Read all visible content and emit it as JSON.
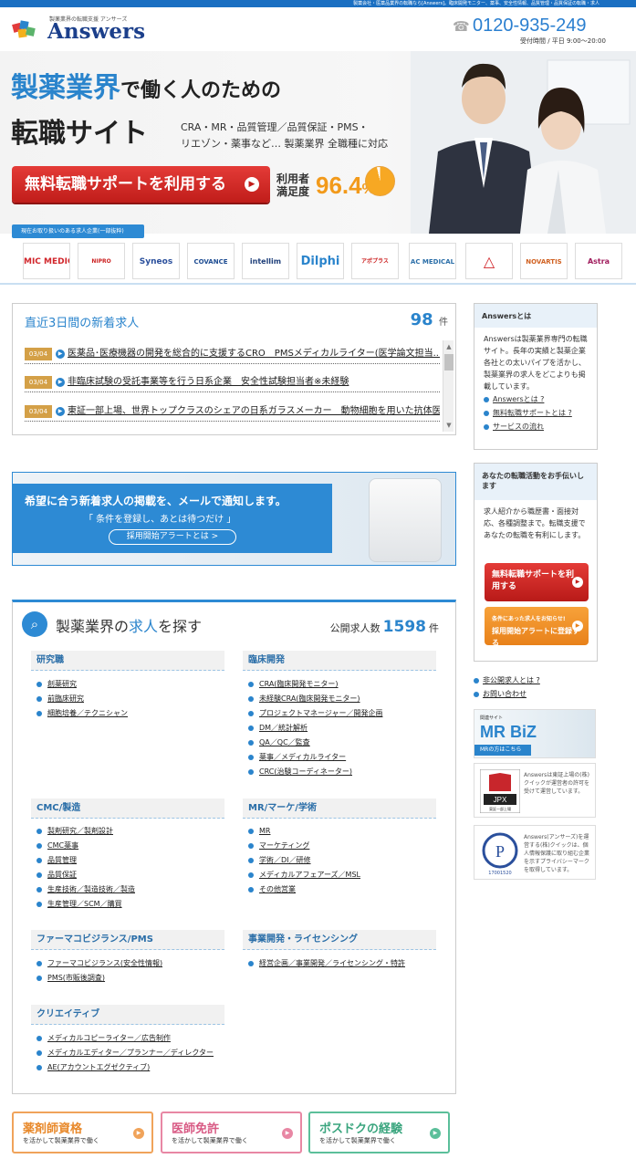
{
  "topbar": {
    "text": "製薬会社・医薬品業界の転職なら[Answers]。臨床開発モニター、薬事、安全性情報、品質管理・品質保証の転職・求人"
  },
  "header": {
    "logo_sub": "製薬業界の転職支援 アンサーズ",
    "logo_text": "Answers",
    "phone": "0120-935-249",
    "hours": "受付時間 / 平日 9:00〜20:00"
  },
  "hero": {
    "title_a": "製薬業界",
    "title_b": "で働く人のための",
    "title_c": "転職サイト",
    "sub1": "CRA・MR・品質管理／品質保証・PMS・",
    "sub2": "リエゾン・薬事など… 製薬業界 全職種に対応",
    "cta": "無料転職サポートを利用する",
    "sat_label": "利用者満足度",
    "sat_value": "96.4",
    "sat_unit": "%"
  },
  "clients": {
    "tag": "現在お取り扱いのある求人企業(一部抜粋)",
    "items": [
      "MIC MEDICAL",
      "NIPRO",
      "Syneos",
      "COVANCE",
      "intellim",
      "Dilphi",
      "アポプラス",
      "AC MEDICAL",
      "△",
      "NOVARTIS",
      "Astra"
    ]
  },
  "jobs": {
    "title": "直近3日間の新着求人",
    "count": "98",
    "unit": "件",
    "rows": [
      {
        "date": "03/04",
        "text": "医薬品･医療機器の開発を総合的に支援するCRO　PMSメディカルライター(医学論文担当..."
      },
      {
        "date": "03/04",
        "text": "非臨床試験の受託事業等を行う日系企業　安全性試験担当者※未経験"
      },
      {
        "date": "03/04",
        "text": "東証一部上場、世界トップクラスのシェアの日系ガラスメーカー　動物細胞を用いた抗体医..."
      }
    ]
  },
  "mail": {
    "title": "希望に合う新着求人の掲載を、メールで通知します。",
    "sub": "「 条件を登録し、あとは待つだけ 」",
    "button": "採用開始アラートとは >"
  },
  "search": {
    "title_a": "製薬業界の",
    "title_b": "求人",
    "title_c": "を探す",
    "public_label": "公開求人数",
    "public_count": "1598",
    "public_unit": "件",
    "categories": [
      {
        "name": "研究職",
        "links": [
          "創薬研究",
          "前臨床研究",
          "細胞培養／テクニシャン"
        ]
      },
      {
        "name": "臨床開発",
        "links": [
          "CRA(臨床開発モニター)",
          "未経験CRA(臨床開発モニター)",
          "プロジェクトマネージャー／開発企画",
          "DM／統計解析",
          "QA／QC／監査",
          "薬事／メディカルライター",
          "CRC(治験コーディネーター)"
        ]
      },
      {
        "name": "CMC/製造",
        "links": [
          "製剤研究／製剤設計",
          "CMC薬事",
          "品質管理",
          "品質保証",
          "生産技術／製造技術／製造",
          "生産管理／SCM／購買"
        ]
      },
      {
        "name": "MR/マーケ/学術",
        "links": [
          "MR",
          "マーケティング",
          "学術／DI／研修",
          "メディカルアフェアーズ／MSL",
          "その他営業"
        ]
      },
      {
        "name": "ファーマコビジランス/PMS",
        "links": [
          "ファーマコビジランス(安全性情報)",
          "PMS(市販後調査)"
        ]
      },
      {
        "name": "事業開発・ライセンシング",
        "links": [
          "経営企画／事業開発／ライセンシング・特許"
        ]
      },
      {
        "name": "クリエイティブ",
        "links": [
          "メディカルコピーライター／広告制作",
          "メディカルエディター／プランナー／ディレクター",
          "AE(アカウントエグゼクティブ)"
        ]
      }
    ]
  },
  "bottom_cards": [
    {
      "title": "薬剤師資格",
      "sub": "を活かして製薬業界で働く",
      "color": "#f0a35a"
    },
    {
      "title": "医師免許",
      "sub": "を活かして製薬業界で働く",
      "color": "#e887a4"
    },
    {
      "title": "ポスドクの経験",
      "sub": "を活かして製薬業界で働く",
      "color": "#5bbf9a"
    }
  ],
  "sidebar": {
    "about_title": "Answersとは",
    "about_body": "Answersは製薬業界専門の転職サイト。長年の実績と製薬企業各社との太いパイプを活かし、製薬業界の求人をどこよりも掲載しています。",
    "about_links": [
      "Answersとは ?",
      "無料転職サポートとは ?",
      "サービスの流れ"
    ],
    "support_title": "あなたの転職活動をお手伝いします",
    "support_body": "求人紹介から職歴書・面接対応、各種調整まで。転職支援であなたの転職を有利にします。",
    "btn_support": "無料転職サポートを利用する",
    "btn_alert_a": "条件にあった求人をお知らせ!",
    "btn_alert_b": "採用開始アラートに登録する",
    "ext_links": [
      "非公開求人とは ?",
      "お問い合わせ"
    ],
    "mrbiz_small": "関連サイト",
    "mrbiz_logo": "MR BiZ",
    "mrbiz_sub": "MRの方はこちら",
    "jpx_label": "JPX",
    "jpx_sub": "東証一部上場",
    "jpx_text": "Answersは東証上場の(株)クイックが運営者の許可を受けて運営しています。",
    "privacy_num": "17001520",
    "privacy_text": "Answers(アンサーズ)を運営する(株)クイックは、個人情報保護に取り組む企業を示すプライバシーマークを取得しています。"
  }
}
